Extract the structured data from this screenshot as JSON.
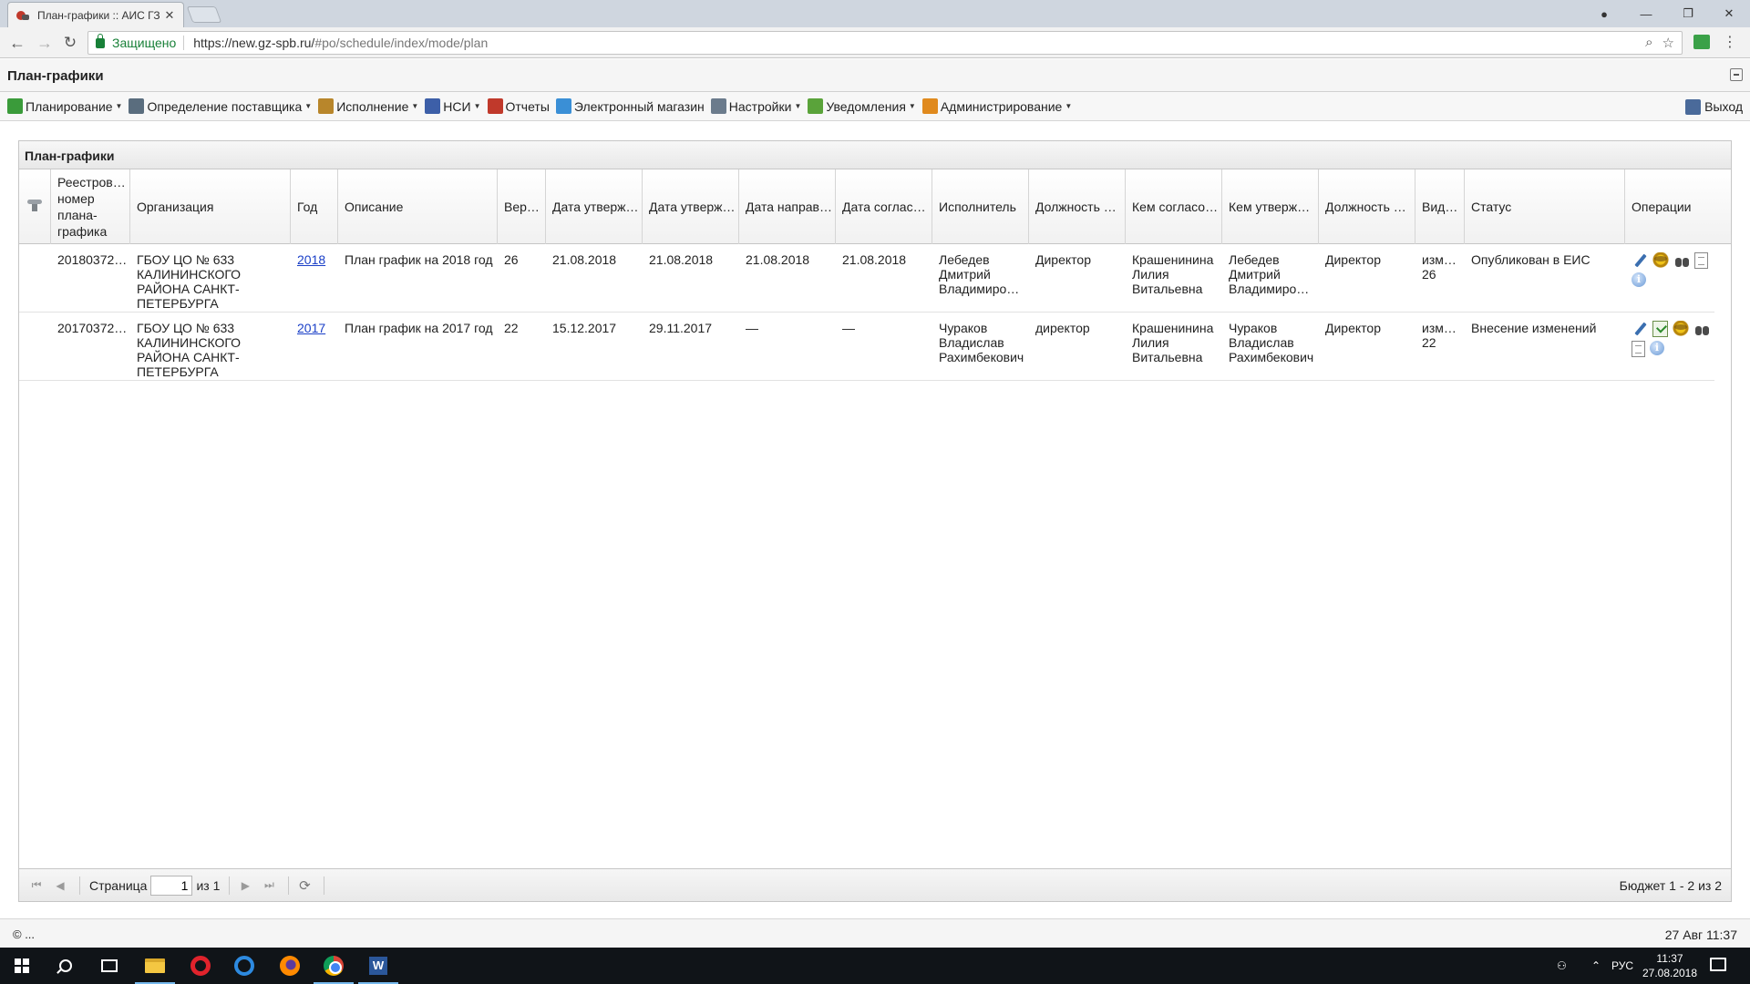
{
  "browser": {
    "tab_title": "План-графики :: АИС ГЗ",
    "tab_close": "✕",
    "secure_label": "Защищено",
    "url_host": "https://new.gz-spb.ru/",
    "url_rest": "#po/schedule/index/mode/plan"
  },
  "app": {
    "title": "План-графики"
  },
  "toolbar": {
    "items": [
      {
        "label": "Планирование",
        "dropdown": true,
        "icon": "planning-icon",
        "color": "#3a9b3a"
      },
      {
        "label": "Определение поставщика",
        "dropdown": true,
        "icon": "gear-icon",
        "color": "#5a6d7e"
      },
      {
        "label": "Исполнение",
        "dropdown": true,
        "icon": "execution-icon",
        "color": "#b8862b"
      },
      {
        "label": "НСИ",
        "dropdown": true,
        "icon": "book-icon",
        "color": "#3d5fa8"
      },
      {
        "label": "Отчеты",
        "dropdown": false,
        "icon": "report-icon",
        "color": "#c0392b"
      },
      {
        "label": "Электронный магазин",
        "dropdown": false,
        "icon": "cart-icon",
        "color": "#3a8fd6"
      },
      {
        "label": "Настройки",
        "dropdown": true,
        "icon": "wrench-icon",
        "color": "#6b7b8c"
      },
      {
        "label": "Уведомления",
        "dropdown": true,
        "icon": "notification-icon",
        "color": "#5aa33a"
      },
      {
        "label": "Администрирование",
        "dropdown": true,
        "icon": "user-icon",
        "color": "#e08a1e"
      }
    ],
    "exit_label": "Выход"
  },
  "panel": {
    "title": "План-графики"
  },
  "grid": {
    "columns": [
      "Реестров… номер плана-графика",
      "Организация",
      "Год",
      "Описание",
      "Вер…",
      "Дата утверж…",
      "Дата утверж…",
      "Дата направ…",
      "Дата соглас…",
      "Исполнитель",
      "Должность …",
      "Кем согласо…",
      "Кем утверж…",
      "Должность …",
      "Вид…",
      "Статус",
      "Операции"
    ],
    "rows": [
      {
        "reg_number": "20180372…",
        "organization": "ГБОУ ЦО № 633 КАЛИНИНСКОГО РАЙОНА САНКТ-ПЕТЕРБУРГА",
        "year": "2018",
        "description": "План график на 2018 год",
        "version": "26",
        "date_approve1": "21.08.2018",
        "date_approve2": "21.08.2018",
        "date_sent": "21.08.2018",
        "date_agreed": "21.08.2018",
        "executor": "Лебедев Дмитрий Владимиро…",
        "position": "Директор",
        "agreed_by": "Крашенинина Лилия Витальевна",
        "approved_by": "Лебедев Дмитрий Владимиро…",
        "position2": "Директор",
        "kind": "изм… 26",
        "status": "Опубликован в ЕИС",
        "ops": [
          "edit",
          "eagle",
          "bino",
          "doc",
          "info"
        ]
      },
      {
        "reg_number": "20170372…",
        "organization": "ГБОУ ЦО № 633 КАЛИНИНСКОГО РАЙОНА САНКТ-ПЕТЕРБУРГА",
        "year": "2017",
        "description": "План график на 2017 год",
        "version": "22",
        "date_approve1": "15.12.2017",
        "date_approve2": "29.11.2017",
        "date_sent": "—",
        "date_agreed": "—",
        "executor": "Чураков Владислав Рахимбекович",
        "position": "директор",
        "agreed_by": "Крашенинина Лилия Витальевна",
        "approved_by": "Чураков Владислав Рахимбекович",
        "position2": "Директор",
        "kind": "изм… 22",
        "status": "Внесение изменений",
        "ops": [
          "edit",
          "check",
          "eagle",
          "bino",
          "doc",
          "info"
        ]
      }
    ]
  },
  "pager": {
    "page_label": "Страница",
    "page_value": "1",
    "of_label": "из 1",
    "summary": "Бюджет 1 - 2 из 2"
  },
  "footer": {
    "copyright": "© ...",
    "datetime": "27 Авг 11:37"
  },
  "taskbar": {
    "lang": "РУС",
    "time": "11:37",
    "date": "27.08.2018"
  }
}
